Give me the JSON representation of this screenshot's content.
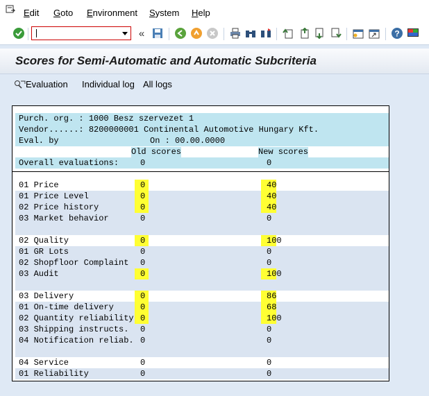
{
  "menu": [
    "Edit",
    "Goto",
    "Environment",
    "System",
    "Help"
  ],
  "menu_underline": [
    "E",
    "G",
    "E",
    "S",
    "H"
  ],
  "title": "Scores for Semi-Automatic and Automatic Subcriteria",
  "app_toolbar": {
    "evaluation": "Evaluation",
    "individual_log": "Individual log",
    "all_logs": "All logs"
  },
  "header": {
    "purch_org": "Purch. org. : 1000 Besz szervezet 1",
    "vendor": "Vendor......: 8200000001 Continental Automotive Hungary Kft.",
    "eval_by": "Eval. by",
    "on": "On : 00.00.0000",
    "old_scores": "Old scores",
    "new_scores": "New scores",
    "overall_label": "Overall evaluations:",
    "overall_old": "0",
    "overall_new": "0"
  },
  "rows": [
    {
      "label": "01 Price",
      "old": "0",
      "new": "40",
      "hl": true,
      "main": true
    },
    {
      "label": "01 Price Level",
      "old": "0",
      "new": "40",
      "hl": true
    },
    {
      "label": "02 Price history",
      "old": "0",
      "new": "40",
      "hl": true
    },
    {
      "label": "03 Market behavior",
      "old": "0",
      "new": "0",
      "hl": false
    },
    {
      "label": "",
      "old": "",
      "new": "",
      "hl": false
    },
    {
      "label": "02 Quality",
      "old": "0",
      "new": "100",
      "hl": true,
      "main": true
    },
    {
      "label": "01 GR Lots",
      "old": "0",
      "new": "0",
      "hl": false
    },
    {
      "label": "02 Shopfloor Complaint",
      "old": "0",
      "new": "0",
      "hl": false
    },
    {
      "label": "03 Audit",
      "old": "0",
      "new": "100",
      "hl": true
    },
    {
      "label": "",
      "old": "",
      "new": "",
      "hl": false
    },
    {
      "label": "03 Delivery",
      "old": "0",
      "new": "86",
      "hl": true,
      "main": true
    },
    {
      "label": "01 On-time delivery",
      "old": "0",
      "new": "68",
      "hl": true
    },
    {
      "label": "02 Quantity reliability",
      "old": "0",
      "new": "100",
      "hl": true
    },
    {
      "label": "03 Shipping instructs.",
      "old": "0",
      "new": "0",
      "hl": false
    },
    {
      "label": "04 Notification reliab.",
      "old": "0",
      "new": "0",
      "hl": false
    },
    {
      "label": "",
      "old": "",
      "new": "",
      "hl": false
    },
    {
      "label": "04 Service",
      "old": "0",
      "new": "0",
      "hl": false,
      "main": true
    },
    {
      "label": "01 Reliability",
      "old": "0",
      "new": "0",
      "hl": false
    }
  ]
}
